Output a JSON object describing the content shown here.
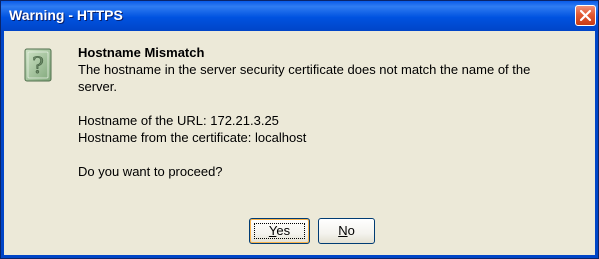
{
  "window": {
    "title": "Warning - HTTPS",
    "close_icon": "close-icon"
  },
  "icon": {
    "name": "question-icon",
    "glyph": "?"
  },
  "message": {
    "heading": "Hostname Mismatch",
    "body_line1": "The hostname in the server security certificate does not match the name of the",
    "body_line2": "server.",
    "url_hostname": "Hostname of the URL: 172.21.3.25",
    "cert_hostname": "Hostname from the certificate: localhost",
    "prompt": "Do you want to proceed?"
  },
  "buttons": {
    "yes": {
      "mnemonic": "Y",
      "rest": "es"
    },
    "no": {
      "mnemonic": "N",
      "rest": "o"
    }
  },
  "colors": {
    "titlebar": "#0052e0",
    "dialog_bg": "#ece9d8",
    "close_button": "#e25a33"
  }
}
